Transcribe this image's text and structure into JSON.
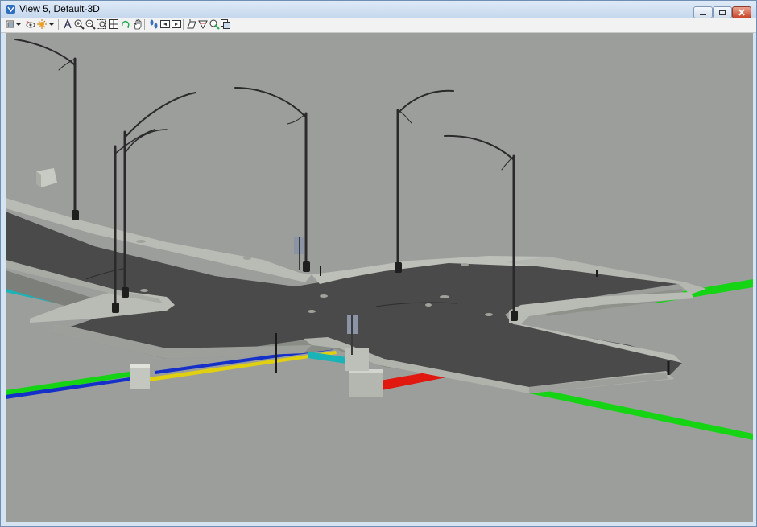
{
  "window": {
    "title": "View 5, Default-3D",
    "icon": "view-window-icon",
    "controls": [
      {
        "name": "minimize-button",
        "icon": "minimize-icon"
      },
      {
        "name": "maximize-button",
        "icon": "maximize-icon"
      },
      {
        "name": "close-button",
        "icon": "close-icon"
      }
    ]
  },
  "toolbar": {
    "tools": [
      {
        "name": "view-display-mode",
        "icon": "display-mode-icon",
        "dropdown": true
      },
      {
        "name": "view-attributes",
        "icon": "view-attributes-icon"
      },
      {
        "name": "lighting",
        "icon": "sun-icon",
        "dropdown": true
      },
      {
        "name": "update-view",
        "icon": "update-view-icon"
      },
      {
        "name": "zoom-in",
        "icon": "zoom-in-icon"
      },
      {
        "name": "zoom-out",
        "icon": "zoom-out-icon"
      },
      {
        "name": "window-area",
        "icon": "window-area-icon"
      },
      {
        "name": "fit-view",
        "icon": "fit-view-icon"
      },
      {
        "name": "rotate-view",
        "icon": "rotate-view-icon"
      },
      {
        "name": "pan-view",
        "icon": "hand-icon"
      },
      {
        "name": "walk",
        "icon": "footprints-icon"
      },
      {
        "name": "view-previous",
        "icon": "view-previous-icon"
      },
      {
        "name": "view-next",
        "icon": "view-next-icon"
      },
      {
        "name": "change-view-perspective",
        "icon": "perspective-icon"
      },
      {
        "name": "clip-volume",
        "icon": "clip-volume-icon"
      },
      {
        "name": "clip-mask",
        "icon": "clip-mask-icon"
      },
      {
        "name": "copy-view",
        "icon": "copy-view-icon"
      }
    ]
  },
  "viewport": {
    "background": "#9c9e9c",
    "road_color": "#4a4a4a",
    "curb_color": "#b9bbb5",
    "utility_colors": {
      "green": "#14d414",
      "blue": "#1430c8",
      "cyan": "#1ab3b8",
      "yellow": "#e0d010",
      "red": "#e01810"
    }
  }
}
